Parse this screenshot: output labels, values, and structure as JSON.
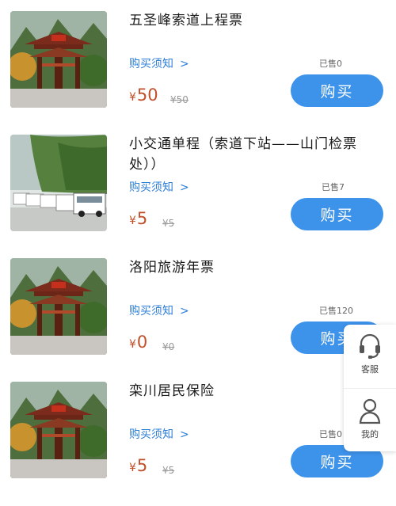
{
  "products": [
    {
      "title": "五圣峰索道上程票",
      "notice": "购买须知",
      "sold": "已售0",
      "currency": "¥",
      "price": "50",
      "original": "¥50",
      "buy": "购买",
      "image": "mountain-gate"
    },
    {
      "title": "小交通单程（索道下站——山门检票处））",
      "notice": "购买须知",
      "sold": "已售7",
      "currency": "¥",
      "price": "5",
      "original": "¥5",
      "buy": "购买",
      "image": "shuttle-buses"
    },
    {
      "title": "洛阳旅游年票",
      "notice": "购买须知",
      "sold": "已售120",
      "currency": "¥",
      "price": "0",
      "original": "¥0",
      "buy": "购买",
      "image": "mountain-gate"
    },
    {
      "title": "栾川居民保险",
      "notice": "购买须知",
      "sold": "已售0",
      "currency": "¥",
      "price": "5",
      "original": "¥5",
      "buy": "购买",
      "image": "mountain-gate"
    }
  ],
  "float_menu": {
    "service_label": "客服",
    "service_icon": "headset-icon",
    "mine_label": "我的",
    "mine_icon": "user-icon"
  },
  "colors": {
    "accent": "#3d92ea",
    "price": "#c0502b",
    "link": "#2f7fd6"
  }
}
